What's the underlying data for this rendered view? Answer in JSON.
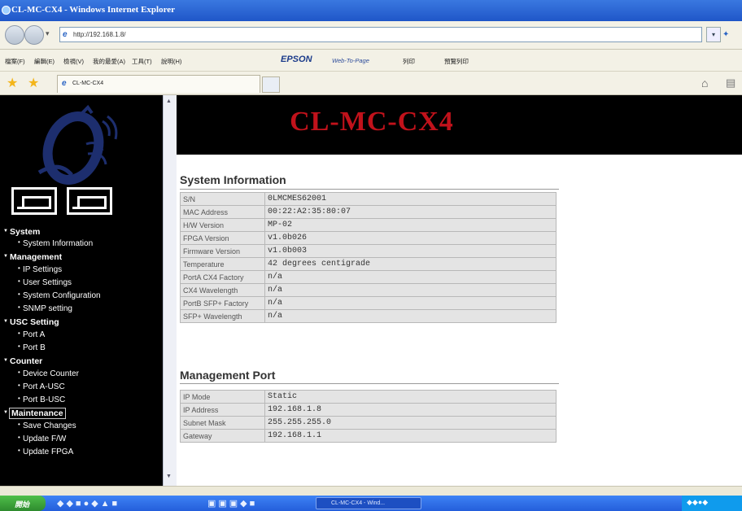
{
  "window": {
    "title": "CL-MC-CX4 - Windows Internet Explorer"
  },
  "address": {
    "url": "http://192.168.1.8/"
  },
  "menubar": {
    "items": [
      "檔案(F)",
      "編輯(E)",
      "檢視(V)",
      "我的最愛(A)",
      "工具(T)",
      "說明(H)"
    ],
    "epson": "EPSON",
    "webtopage": "Web-To-Page",
    "print": "列印",
    "preview": "預覽列印"
  },
  "tab": {
    "label": "CL-MC-CX4"
  },
  "banner": {
    "title": "CL-MC-CX4"
  },
  "sidebar": {
    "sections": [
      {
        "label": "System",
        "items": [
          "System Information"
        ]
      },
      {
        "label": "Management",
        "items": [
          "IP Settings",
          "User Settings",
          "System Configuration",
          "SNMP setting"
        ]
      },
      {
        "label": "USC Setting",
        "items": [
          "Port A",
          "Port B"
        ]
      },
      {
        "label": "Counter",
        "items": [
          "Device Counter",
          "Port A-USC",
          "Port B-USC"
        ]
      },
      {
        "label": "Maintenance",
        "items": [
          "Save Changes",
          "Update F/W",
          "Update FPGA"
        ]
      }
    ]
  },
  "system_info": {
    "title": "System Information",
    "rows": [
      {
        "label": "S/N",
        "value": "0LMCMES62001"
      },
      {
        "label": "MAC Address",
        "value": "00:22:A2:35:80:07"
      },
      {
        "label": "H/W Version",
        "value": "MP-02"
      },
      {
        "label": "FPGA Version",
        "value": "v1.0b026"
      },
      {
        "label": "Firmware Version",
        "value": "v1.0b003"
      },
      {
        "label": "Temperature",
        "value": "42 degrees centigrade"
      },
      {
        "label": "PortA CX4 Factory",
        "value": "n/a"
      },
      {
        "label": "CX4 Wavelength",
        "value": "n/a"
      },
      {
        "label": "PortB SFP+ Factory",
        "value": "n/a"
      },
      {
        "label": "SFP+ Wavelength",
        "value": "n/a"
      }
    ]
  },
  "mgmt_port": {
    "title": "Management Port",
    "rows": [
      {
        "label": "IP Mode",
        "value": "Static"
      },
      {
        "label": "IP Address",
        "value": "192.168.1.8"
      },
      {
        "label": "Subnet Mask",
        "value": "255.255.255.0"
      },
      {
        "label": "Gateway",
        "value": "192.168.1.1"
      }
    ]
  },
  "taskbar": {
    "start": "開始",
    "window": "CL-MC-CX4 - Wind..."
  },
  "colors": {
    "banner_text": "#c1121b",
    "sidebar_bg": "#000000",
    "table_bg": "#e4e4e4"
  }
}
